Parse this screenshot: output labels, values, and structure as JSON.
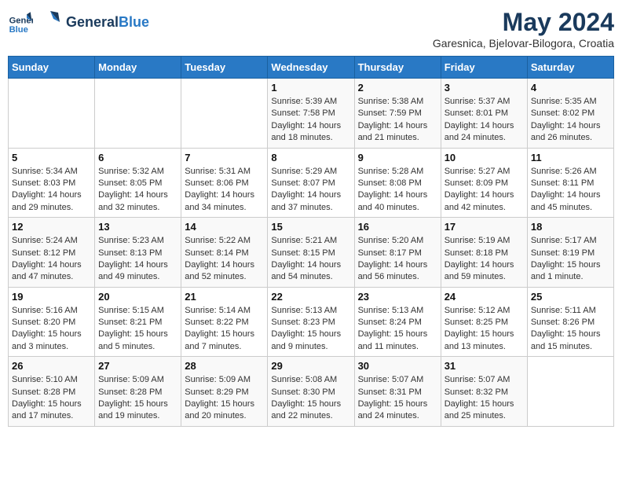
{
  "header": {
    "logo_general": "General",
    "logo_blue": "Blue",
    "title": "May 2024",
    "subtitle": "Garesnica, Bjelovar-Bilogora, Croatia"
  },
  "days_of_week": [
    "Sunday",
    "Monday",
    "Tuesday",
    "Wednesday",
    "Thursday",
    "Friday",
    "Saturday"
  ],
  "weeks": [
    [
      {
        "day": "",
        "sunrise": "",
        "sunset": "",
        "daylight": ""
      },
      {
        "day": "",
        "sunrise": "",
        "sunset": "",
        "daylight": ""
      },
      {
        "day": "",
        "sunrise": "",
        "sunset": "",
        "daylight": ""
      },
      {
        "day": "1",
        "sunrise": "Sunrise: 5:39 AM",
        "sunset": "Sunset: 7:58 PM",
        "daylight": "Daylight: 14 hours and 18 minutes."
      },
      {
        "day": "2",
        "sunrise": "Sunrise: 5:38 AM",
        "sunset": "Sunset: 7:59 PM",
        "daylight": "Daylight: 14 hours and 21 minutes."
      },
      {
        "day": "3",
        "sunrise": "Sunrise: 5:37 AM",
        "sunset": "Sunset: 8:01 PM",
        "daylight": "Daylight: 14 hours and 24 minutes."
      },
      {
        "day": "4",
        "sunrise": "Sunrise: 5:35 AM",
        "sunset": "Sunset: 8:02 PM",
        "daylight": "Daylight: 14 hours and 26 minutes."
      }
    ],
    [
      {
        "day": "5",
        "sunrise": "Sunrise: 5:34 AM",
        "sunset": "Sunset: 8:03 PM",
        "daylight": "Daylight: 14 hours and 29 minutes."
      },
      {
        "day": "6",
        "sunrise": "Sunrise: 5:32 AM",
        "sunset": "Sunset: 8:05 PM",
        "daylight": "Daylight: 14 hours and 32 minutes."
      },
      {
        "day": "7",
        "sunrise": "Sunrise: 5:31 AM",
        "sunset": "Sunset: 8:06 PM",
        "daylight": "Daylight: 14 hours and 34 minutes."
      },
      {
        "day": "8",
        "sunrise": "Sunrise: 5:29 AM",
        "sunset": "Sunset: 8:07 PM",
        "daylight": "Daylight: 14 hours and 37 minutes."
      },
      {
        "day": "9",
        "sunrise": "Sunrise: 5:28 AM",
        "sunset": "Sunset: 8:08 PM",
        "daylight": "Daylight: 14 hours and 40 minutes."
      },
      {
        "day": "10",
        "sunrise": "Sunrise: 5:27 AM",
        "sunset": "Sunset: 8:09 PM",
        "daylight": "Daylight: 14 hours and 42 minutes."
      },
      {
        "day": "11",
        "sunrise": "Sunrise: 5:26 AM",
        "sunset": "Sunset: 8:11 PM",
        "daylight": "Daylight: 14 hours and 45 minutes."
      }
    ],
    [
      {
        "day": "12",
        "sunrise": "Sunrise: 5:24 AM",
        "sunset": "Sunset: 8:12 PM",
        "daylight": "Daylight: 14 hours and 47 minutes."
      },
      {
        "day": "13",
        "sunrise": "Sunrise: 5:23 AM",
        "sunset": "Sunset: 8:13 PM",
        "daylight": "Daylight: 14 hours and 49 minutes."
      },
      {
        "day": "14",
        "sunrise": "Sunrise: 5:22 AM",
        "sunset": "Sunset: 8:14 PM",
        "daylight": "Daylight: 14 hours and 52 minutes."
      },
      {
        "day": "15",
        "sunrise": "Sunrise: 5:21 AM",
        "sunset": "Sunset: 8:15 PM",
        "daylight": "Daylight: 14 hours and 54 minutes."
      },
      {
        "day": "16",
        "sunrise": "Sunrise: 5:20 AM",
        "sunset": "Sunset: 8:17 PM",
        "daylight": "Daylight: 14 hours and 56 minutes."
      },
      {
        "day": "17",
        "sunrise": "Sunrise: 5:19 AM",
        "sunset": "Sunset: 8:18 PM",
        "daylight": "Daylight: 14 hours and 59 minutes."
      },
      {
        "day": "18",
        "sunrise": "Sunrise: 5:17 AM",
        "sunset": "Sunset: 8:19 PM",
        "daylight": "Daylight: 15 hours and 1 minute."
      }
    ],
    [
      {
        "day": "19",
        "sunrise": "Sunrise: 5:16 AM",
        "sunset": "Sunset: 8:20 PM",
        "daylight": "Daylight: 15 hours and 3 minutes."
      },
      {
        "day": "20",
        "sunrise": "Sunrise: 5:15 AM",
        "sunset": "Sunset: 8:21 PM",
        "daylight": "Daylight: 15 hours and 5 minutes."
      },
      {
        "day": "21",
        "sunrise": "Sunrise: 5:14 AM",
        "sunset": "Sunset: 8:22 PM",
        "daylight": "Daylight: 15 hours and 7 minutes."
      },
      {
        "day": "22",
        "sunrise": "Sunrise: 5:13 AM",
        "sunset": "Sunset: 8:23 PM",
        "daylight": "Daylight: 15 hours and 9 minutes."
      },
      {
        "day": "23",
        "sunrise": "Sunrise: 5:13 AM",
        "sunset": "Sunset: 8:24 PM",
        "daylight": "Daylight: 15 hours and 11 minutes."
      },
      {
        "day": "24",
        "sunrise": "Sunrise: 5:12 AM",
        "sunset": "Sunset: 8:25 PM",
        "daylight": "Daylight: 15 hours and 13 minutes."
      },
      {
        "day": "25",
        "sunrise": "Sunrise: 5:11 AM",
        "sunset": "Sunset: 8:26 PM",
        "daylight": "Daylight: 15 hours and 15 minutes."
      }
    ],
    [
      {
        "day": "26",
        "sunrise": "Sunrise: 5:10 AM",
        "sunset": "Sunset: 8:28 PM",
        "daylight": "Daylight: 15 hours and 17 minutes."
      },
      {
        "day": "27",
        "sunrise": "Sunrise: 5:09 AM",
        "sunset": "Sunset: 8:28 PM",
        "daylight": "Daylight: 15 hours and 19 minutes."
      },
      {
        "day": "28",
        "sunrise": "Sunrise: 5:09 AM",
        "sunset": "Sunset: 8:29 PM",
        "daylight": "Daylight: 15 hours and 20 minutes."
      },
      {
        "day": "29",
        "sunrise": "Sunrise: 5:08 AM",
        "sunset": "Sunset: 8:30 PM",
        "daylight": "Daylight: 15 hours and 22 minutes."
      },
      {
        "day": "30",
        "sunrise": "Sunrise: 5:07 AM",
        "sunset": "Sunset: 8:31 PM",
        "daylight": "Daylight: 15 hours and 24 minutes."
      },
      {
        "day": "31",
        "sunrise": "Sunrise: 5:07 AM",
        "sunset": "Sunset: 8:32 PM",
        "daylight": "Daylight: 15 hours and 25 minutes."
      },
      {
        "day": "",
        "sunrise": "",
        "sunset": "",
        "daylight": ""
      }
    ]
  ]
}
